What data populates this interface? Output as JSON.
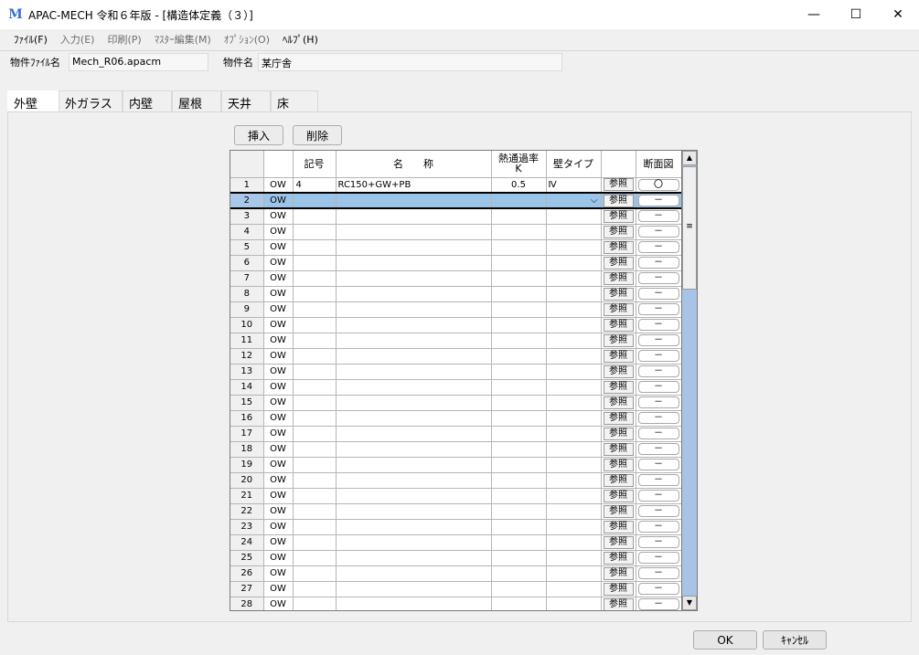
{
  "window": {
    "title": "APAC-MECH 令和６年版 - [構造体定義（３）]",
    "icon": "M"
  },
  "menu": [
    {
      "label": "ﾌｧｲﾙ(F)",
      "dim": false
    },
    {
      "label": "入力(E)",
      "dim": true
    },
    {
      "label": "印刷(P)",
      "dim": true
    },
    {
      "label": "ﾏｽﾀｰ編集(M)",
      "dim": true
    },
    {
      "label": "ｵﾌﾟｼｮﾝ(O)",
      "dim": true
    },
    {
      "label": "ﾍﾙﾌﾟ(H)",
      "dim": false
    }
  ],
  "info": {
    "file_label": "物件ﾌｧｲﾙ名",
    "file_value": "Mech_R06.apacm",
    "name_label": "物件名",
    "name_value": "某庁舎"
  },
  "tabs": [
    "外壁",
    "外ガラス",
    "内壁",
    "屋根",
    "天井",
    "床"
  ],
  "buttons": {
    "insert": "挿入",
    "delete": "削除",
    "ok": "OK",
    "cancel": "ｷｬﾝｾﾙ"
  },
  "grid": {
    "headers": {
      "symbol": "記号",
      "name": "名　　称",
      "k_line1": "熱通過率",
      "k_line2": "K",
      "wall_type": "壁タイプ",
      "section": "断面図"
    },
    "ref_label": "参照",
    "dash_label": "－",
    "type_code": "OW",
    "rows": [
      {
        "num": "1",
        "code": "OW",
        "symbol": "4",
        "name": "RC150+GW+PB",
        "k": "0.5",
        "wall": "Ⅳ",
        "section": "〇"
      },
      {
        "num": "2",
        "code": "OW",
        "symbol": "",
        "name": "",
        "k": "",
        "wall": "",
        "section": "－",
        "selected": true
      },
      {
        "num": "3"
      },
      {
        "num": "4"
      },
      {
        "num": "5"
      },
      {
        "num": "6"
      },
      {
        "num": "7"
      },
      {
        "num": "8"
      },
      {
        "num": "9"
      },
      {
        "num": "10"
      },
      {
        "num": "11"
      },
      {
        "num": "12"
      },
      {
        "num": "13"
      },
      {
        "num": "14"
      },
      {
        "num": "15"
      },
      {
        "num": "16"
      },
      {
        "num": "17"
      },
      {
        "num": "18"
      },
      {
        "num": "19"
      },
      {
        "num": "20"
      },
      {
        "num": "21"
      },
      {
        "num": "22"
      },
      {
        "num": "23"
      },
      {
        "num": "24"
      },
      {
        "num": "25"
      },
      {
        "num": "26"
      },
      {
        "num": "27"
      },
      {
        "num": "28"
      }
    ]
  }
}
